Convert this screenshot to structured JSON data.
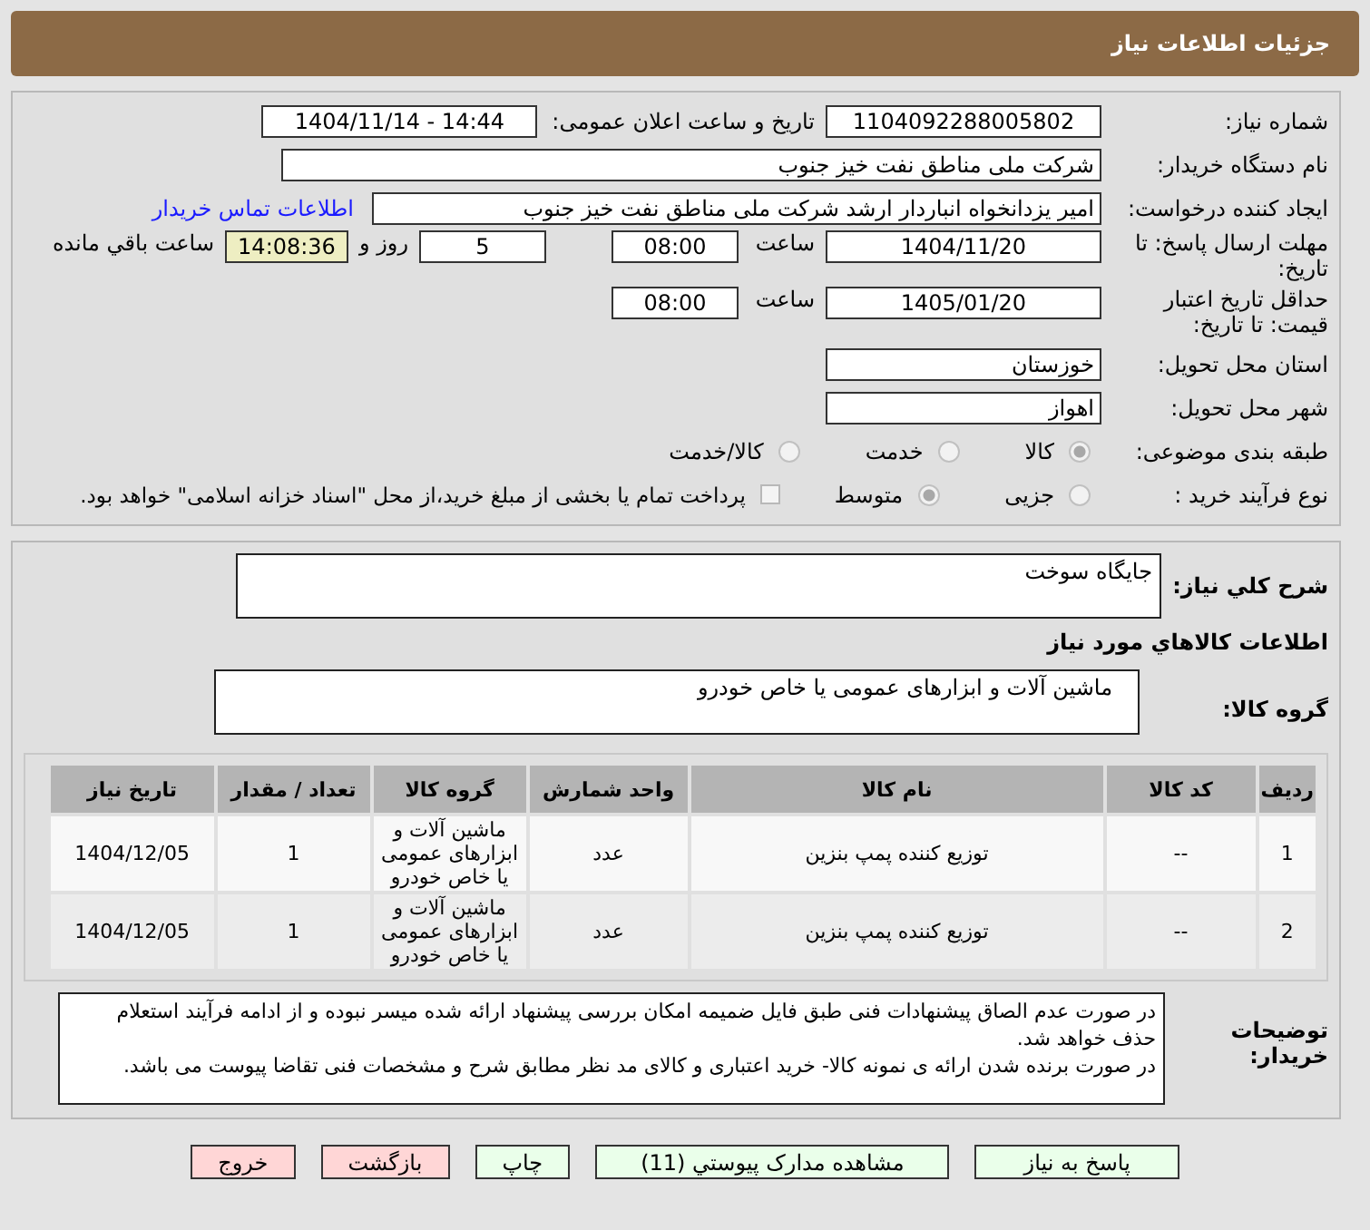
{
  "header": {
    "title": "جزئیات اطلاعات نیاز"
  },
  "need_number": {
    "label": "شماره نیاز:",
    "value": "1104092288005802"
  },
  "announce": {
    "label": "تاریخ و ساعت اعلان عمومی:",
    "value": "1404/11/14 - 14:44"
  },
  "buyer": {
    "label": "نام دستگاه خریدار:",
    "value": "شرکت ملی مناطق نفت خیز جنوب"
  },
  "creator": {
    "label": "ایجاد کننده درخواست:",
    "value": "امیر یزدانخواه انباردار ارشد شرکت ملی مناطق نفت خیز جنوب",
    "link": "اطلاعات تماس خریدار"
  },
  "deadline": {
    "label": "مهلت ارسال پاسخ: تا تاریخ:",
    "date": "1404/11/20",
    "time_label": "ساعت",
    "time": "08:00",
    "days": "5",
    "days_label": "روز و",
    "remaining": "14:08:36",
    "remaining_label": "ساعت باقي مانده"
  },
  "validity": {
    "label": "حداقل تاریخ اعتبار قیمت: تا تاریخ:",
    "date": "1405/01/20",
    "time_label": "ساعت",
    "time": "08:00"
  },
  "province": {
    "label": "استان محل تحویل:",
    "value": "خوزستان"
  },
  "city": {
    "label": "شهر محل تحویل:",
    "value": "اهواز"
  },
  "category": {
    "label": "طبقه بندی موضوعی:",
    "options": [
      {
        "label": "کالا",
        "selected": true
      },
      {
        "label": "خدمت",
        "selected": false
      },
      {
        "label": "کالا/خدمت",
        "selected": false
      }
    ]
  },
  "purchase_type": {
    "label": "نوع فرآیند خرید :",
    "options": [
      {
        "label": "جزیی",
        "selected": false
      },
      {
        "label": "متوسط",
        "selected": true
      }
    ],
    "payment": {
      "checked": false,
      "text": "پرداخت تمام یا بخشی از مبلغ خرید،از محل \"اسناد خزانه اسلامی\" خواهد بود."
    }
  },
  "description": {
    "label": "شرح کلي نياز:",
    "value": "جایگاه سوخت"
  },
  "goods_heading": "اطلاعات کالاهاي مورد نياز",
  "goods_group": {
    "label": "گروه کالا:",
    "value": "ماشین آلات و ابزارهای عمومی یا خاص خودرو"
  },
  "table": {
    "columns": [
      "ردیف",
      "کد کالا",
      "نام کالا",
      "واحد شمارش",
      "گروه کالا",
      "تعداد / مقدار",
      "تاریخ نیاز"
    ],
    "rows": [
      [
        "1",
        "--",
        "توزیع کننده پمپ بنزین",
        "عدد",
        "ماشین آلات و ابزارهای عمومی یا خاص خودرو",
        "1",
        "1404/12/05"
      ],
      [
        "2",
        "--",
        "توزیع کننده پمپ بنزین",
        "عدد",
        "ماشین آلات و ابزارهای عمومی یا خاص خودرو",
        "1",
        "1404/12/05"
      ]
    ]
  },
  "notes": {
    "label": "توضیحات خریدار:",
    "lines": [
      "در صورت عدم الصاق پیشنهادات فنی طبق فایل ضمیمه امکان بررسی پیشنهاد ارائه شده میسر نبوده و از ادامه فرآیند استعلام حذف خواهد شد.",
      "در صورت برنده شدن ارائه ی نمونه کالا- خرید اعتباری و کالای مد نظر مطابق شرح و مشخصات فنی تقاضا پیوست می باشد."
    ]
  },
  "buttons": [
    {
      "label": "پاسخ به نیاز",
      "kind": "green"
    },
    {
      "label": "مشاهده مدارک پیوستي (11)",
      "kind": "green"
    },
    {
      "label": "چاپ",
      "kind": "green"
    },
    {
      "label": "بازگشت",
      "kind": "red"
    },
    {
      "label": "خروج",
      "kind": "red"
    }
  ]
}
